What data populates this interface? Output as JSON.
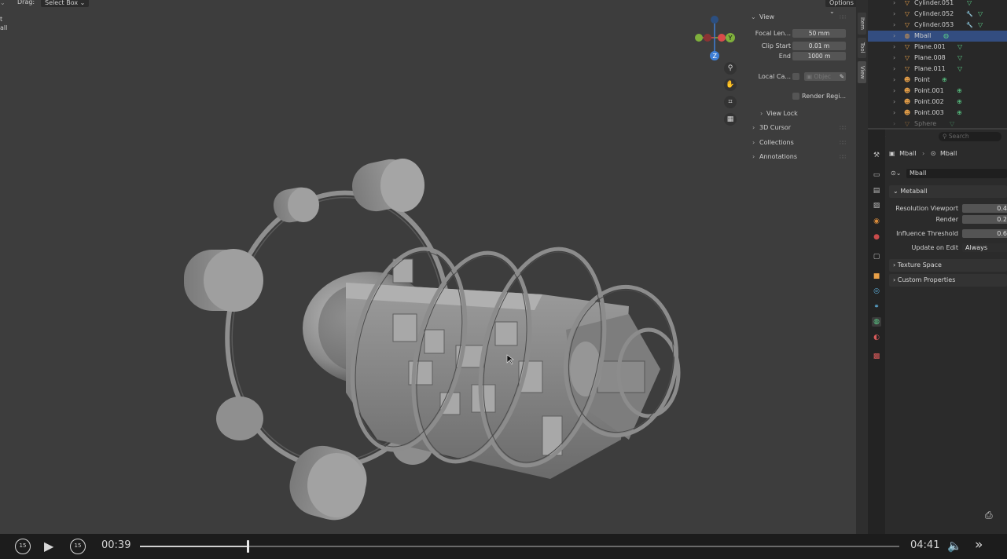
{
  "viewport_header": {
    "drag_label": "Drag:",
    "select_mode": "Select Box",
    "options_label": "Options",
    "left_fragment_1": "t",
    "left_fragment_2": "all"
  },
  "gizmo": {
    "axis_x": "X",
    "axis_y": "Y",
    "axis_z": "Z"
  },
  "view_panel": {
    "title": "View",
    "focal_label": "Focal Len...",
    "focal_value": "50 mm",
    "clip_start_label": "Clip Start",
    "clip_start_value": "0.01 m",
    "end_label": "End",
    "end_value": "1000 m",
    "local_camera_label": "Local Ca...",
    "local_camera_placeholder": "Objec",
    "render_region_label": "Render Regi...",
    "view_lock_label": "View Lock",
    "sections": [
      "3D Cursor",
      "Collections",
      "Annotations"
    ]
  },
  "side_tabs": [
    "Item",
    "Tool",
    "View"
  ],
  "outliner": {
    "items": [
      {
        "name": "Cylinder.051",
        "icon": "mesh-icon",
        "mod": false,
        "selected": false
      },
      {
        "name": "Cylinder.052",
        "icon": "mesh-icon",
        "mod": true,
        "selected": false
      },
      {
        "name": "Cylinder.053",
        "icon": "mesh-icon",
        "mod": true,
        "selected": false
      },
      {
        "name": "Mball",
        "icon": "metaball-icon",
        "mod": false,
        "selected": true
      },
      {
        "name": "Plane.001",
        "icon": "mesh-icon",
        "mod": false,
        "selected": false
      },
      {
        "name": "Plane.008",
        "icon": "mesh-icon",
        "mod": false,
        "selected": false
      },
      {
        "name": "Plane.011",
        "icon": "mesh-icon",
        "mod": false,
        "selected": false
      },
      {
        "name": "Point",
        "icon": "light-icon",
        "mod": false,
        "selected": false
      },
      {
        "name": "Point.001",
        "icon": "light-icon",
        "mod": false,
        "selected": false
      },
      {
        "name": "Point.002",
        "icon": "light-icon",
        "mod": false,
        "selected": false
      },
      {
        "name": "Point.003",
        "icon": "light-icon",
        "mod": false,
        "selected": false
      },
      {
        "name": "Sphere",
        "icon": "mesh-icon",
        "mod": false,
        "selected": false
      }
    ]
  },
  "properties": {
    "search_placeholder": "Search",
    "breadcrumb_object": "Mball",
    "breadcrumb_data": "Mball",
    "datablock_name": "Mball",
    "metaball_section": "Metaball",
    "resolution_viewport_label": "Resolution Viewport",
    "resolution_viewport_value": "0.4",
    "render_label": "Render",
    "render_value": "0.2",
    "influence_label": "Influence Threshold",
    "influence_value": "0.6",
    "update_label": "Update on Edit",
    "update_value": "Always",
    "texture_space_label": "Texture Space",
    "custom_properties_label": "Custom Properties"
  },
  "player": {
    "current_time": "00:39",
    "total_time": "04:41",
    "skip_back_label": "15",
    "skip_forward_label": "15",
    "progress": 0.142
  },
  "colors": {
    "accent_selected": "#334d80",
    "mesh_orange": "#e8a048",
    "data_green": "#5cd089",
    "modifier_blue": "#5fb3e0",
    "axis_x": "#d94b4b",
    "axis_y": "#7fb03c",
    "axis_z": "#3f7fd6"
  }
}
